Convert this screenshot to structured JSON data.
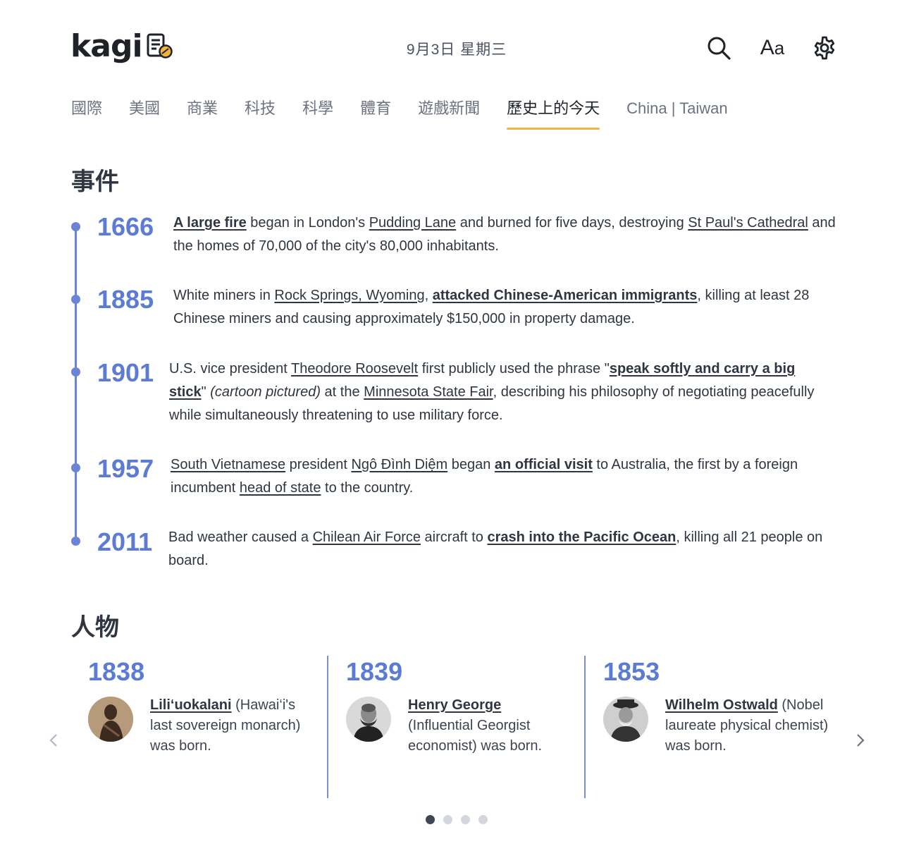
{
  "header": {
    "logo_text": "kagi",
    "date": "9月3日 星期三",
    "icons": {
      "search": "search-icon",
      "font": "font-size-icon",
      "settings": "gear-icon",
      "logo_badge": "news-badge-icon"
    },
    "font_button_label_large": "A",
    "font_button_label_small": "a"
  },
  "tabs": [
    {
      "label": "國際",
      "active": false
    },
    {
      "label": "美國",
      "active": false
    },
    {
      "label": "商業",
      "active": false
    },
    {
      "label": "科技",
      "active": false
    },
    {
      "label": "科學",
      "active": false
    },
    {
      "label": "體育",
      "active": false
    },
    {
      "label": "遊戲新聞",
      "active": false
    },
    {
      "label": "歷史上的今天",
      "active": true
    },
    {
      "label": "China | Taiwan",
      "active": false
    }
  ],
  "events_section": {
    "title": "事件",
    "events": [
      {
        "year": "1666",
        "parts": [
          {
            "t": "A large fire",
            "link": true,
            "bold": true
          },
          {
            "t": " began in London's "
          },
          {
            "t": "Pudding Lane",
            "link": true
          },
          {
            "t": " and burned for five days, destroying "
          },
          {
            "t": "St Paul's Cathedral",
            "link": true
          },
          {
            "t": " and the homes of 70,000 of the city's 80,000 inhabitants."
          }
        ]
      },
      {
        "year": "1885",
        "parts": [
          {
            "t": "White miners in "
          },
          {
            "t": "Rock Springs, Wyoming",
            "link": true
          },
          {
            "t": ", "
          },
          {
            "t": "attacked Chinese-American immigrants",
            "link": true,
            "bold": true
          },
          {
            "t": ", killing at least 28 Chinese miners and causing approximately $150,000 in property damage."
          }
        ]
      },
      {
        "year": "1901",
        "parts": [
          {
            "t": "U.S. vice president "
          },
          {
            "t": "Theodore Roosevelt",
            "link": true
          },
          {
            "t": " first publicly used the phrase \""
          },
          {
            "t": "speak softly and carry a big stick",
            "link": true,
            "bold": true
          },
          {
            "t": "\" "
          },
          {
            "t": "(cartoon pictured)",
            "italic": true
          },
          {
            "t": " at the "
          },
          {
            "t": "Minnesota State Fair",
            "link": true
          },
          {
            "t": ", describing his philosophy of negotiating peacefully while simultaneously threatening to use military force."
          }
        ]
      },
      {
        "year": "1957",
        "parts": [
          {
            "t": "South Vietnamese",
            "link": true
          },
          {
            "t": " president "
          },
          {
            "t": "Ngô Đình Diệm",
            "link": true
          },
          {
            "t": " began "
          },
          {
            "t": "an official visit",
            "link": true,
            "bold": true
          },
          {
            "t": " to Australia, the first by a foreign incumbent "
          },
          {
            "t": "head of state",
            "link": true
          },
          {
            "t": " to the country."
          }
        ]
      },
      {
        "year": "2011",
        "parts": [
          {
            "t": "Bad weather caused a "
          },
          {
            "t": "Chilean Air Force",
            "link": true
          },
          {
            "t": " aircraft to "
          },
          {
            "t": "crash into the Pacific Ocean",
            "link": true,
            "bold": true
          },
          {
            "t": ", killing all 21 people on board."
          }
        ]
      }
    ]
  },
  "people_section": {
    "title": "人物",
    "people": [
      {
        "year": "1838",
        "name": "Lili‘uokalani",
        "desc": " (Hawai‘i's last sovereign monarch) was born.",
        "avatar": "portrait-liliuokalani"
      },
      {
        "year": "1839",
        "name": "Henry George",
        "desc": " (Influential Georgist economist) was born.",
        "avatar": "portrait-henry-george"
      },
      {
        "year": "1853",
        "name": "Wilhelm Ostwald",
        "desc": " (Nobel laureate physical chemist) was born.",
        "avatar": "portrait-wilhelm-ostwald"
      }
    ],
    "prev_icon": "chevron-left-icon",
    "next_icon": "chevron-right-icon",
    "page_count": 4,
    "active_page": 1
  },
  "colors": {
    "accent_blue": "#5b7bd5",
    "timeline_blue": "#6b84d8",
    "tab_underline": "#f0b33c",
    "text_dark": "#2f3641",
    "text_muted": "#6b7280"
  }
}
